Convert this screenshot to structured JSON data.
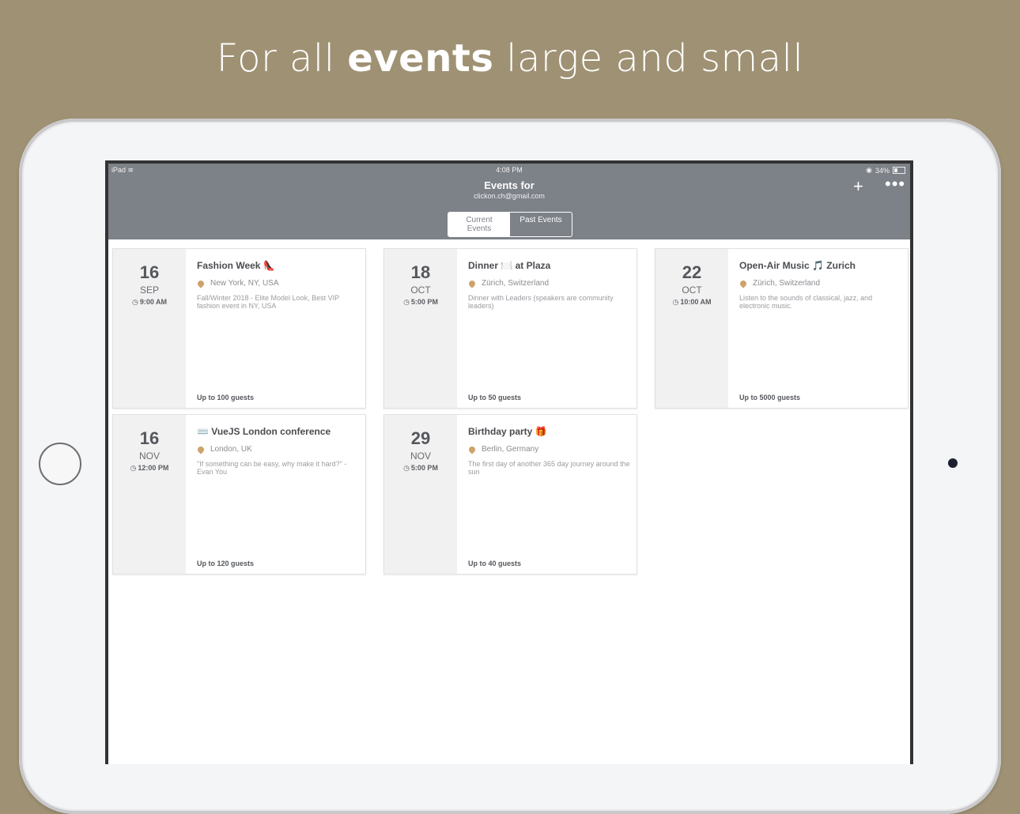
{
  "headline": {
    "prefix": "For all ",
    "bold": "events",
    "suffix": " large and small"
  },
  "status_bar": {
    "device": "iPad",
    "time": "4:08 PM",
    "battery": "34%"
  },
  "nav": {
    "title": "Events for",
    "subtitle": "clickon.ch@gmail.com",
    "add_label": "+",
    "more_label": "•••"
  },
  "tabs": [
    {
      "label": "Current Events",
      "active": true
    },
    {
      "label": "Past Events",
      "active": false
    }
  ],
  "events": [
    {
      "day": "16",
      "month": "SEP",
      "time": "9:00 AM",
      "title": "Fashion Week 👠",
      "location": "New York, NY, USA",
      "description": "Fall/Winter 2018 - Elite Model Look, Best VIP fashion event in NY, USA",
      "guests": "Up to 100 guests"
    },
    {
      "day": "18",
      "month": "OCT",
      "time": "5:00 PM",
      "title": "Dinner 🍽️ at Plaza",
      "location": "Zürich, Switzerland",
      "description": "Dinner with Leaders (speakers are community leaders)",
      "guests": "Up to 50 guests"
    },
    {
      "day": "22",
      "month": "OCT",
      "time": "10:00 AM",
      "title": "Open-Air Music 🎵 Zurich",
      "location": "Zürich, Switzerland",
      "description": "Listen to the sounds of classical, jazz, and electronic music.",
      "guests": "Up to 5000 guests"
    },
    {
      "day": "16",
      "month": "NOV",
      "time": "12:00 PM",
      "title": "⌨️ VueJS London conference",
      "location": "London, UK",
      "description": "\"If something can be easy, why make it hard?\" - Evan You",
      "guests": "Up to 120 guests"
    },
    {
      "day": "29",
      "month": "NOV",
      "time": "5:00 PM",
      "title": "Birthday party 🎁",
      "location": "Berlin, Germany",
      "description": "The first day of another 365 day journey around the sun",
      "guests": "Up to 40 guests"
    }
  ]
}
